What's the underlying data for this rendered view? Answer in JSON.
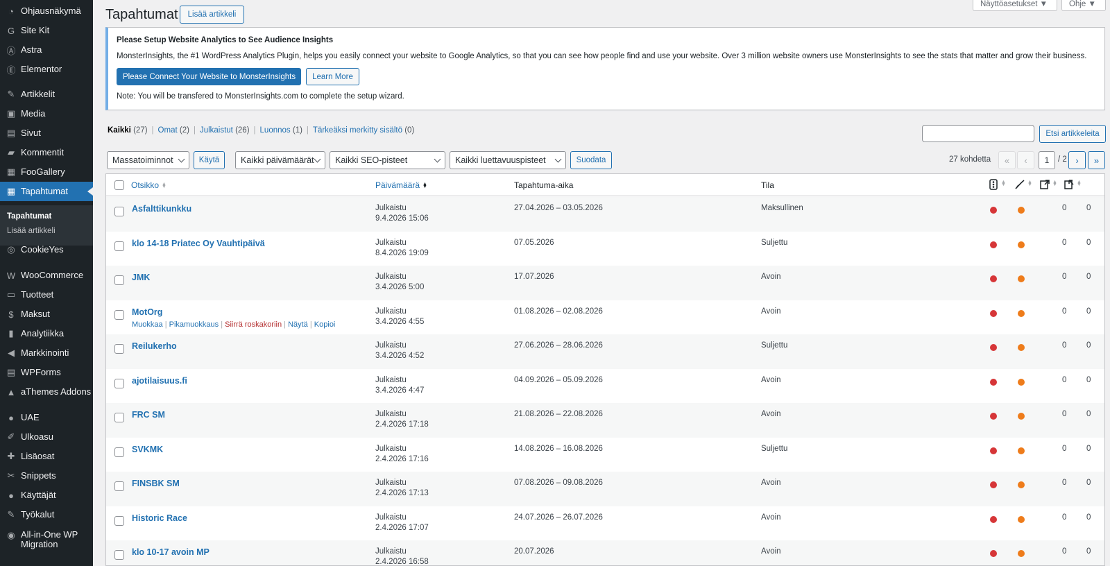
{
  "sidebar": {
    "items": [
      {
        "label": "Ohjausnäkymä",
        "icon": "dashboard-icon",
        "glyph": "◔"
      },
      {
        "label": "Site Kit",
        "icon": "site-kit-icon",
        "glyph": "G"
      },
      {
        "label": "Astra",
        "icon": "astra-icon",
        "glyph": "Ⓐ"
      },
      {
        "label": "Elementor",
        "icon": "elementor-icon",
        "glyph": "Ⓔ"
      },
      {
        "label": "Artikkelit",
        "icon": "pin-icon",
        "glyph": "✎"
      },
      {
        "label": "Media",
        "icon": "media-icon",
        "glyph": "▣"
      },
      {
        "label": "Sivut",
        "icon": "pages-icon",
        "glyph": "▤"
      },
      {
        "label": "Kommentit",
        "icon": "comments-icon",
        "glyph": "▰"
      },
      {
        "label": "FooGallery",
        "icon": "gallery-icon",
        "glyph": "▦"
      },
      {
        "label": "Tapahtumat",
        "icon": "calendar-icon",
        "glyph": "▦"
      },
      {
        "label": "CookieYes",
        "icon": "cookie-icon",
        "glyph": "◎"
      },
      {
        "label": "WooCommerce",
        "icon": "woocommerce-icon",
        "glyph": "W"
      },
      {
        "label": "Tuotteet",
        "icon": "products-icon",
        "glyph": "▭"
      },
      {
        "label": "Maksut",
        "icon": "payments-icon",
        "glyph": "$"
      },
      {
        "label": "Analytiikka",
        "icon": "analytics-icon",
        "glyph": "▮"
      },
      {
        "label": "Markkinointi",
        "icon": "marketing-icon",
        "glyph": "◀"
      },
      {
        "label": "WPForms",
        "icon": "wpforms-icon",
        "glyph": "▤"
      },
      {
        "label": "aThemes Addons",
        "icon": "athemes-icon",
        "glyph": "▲"
      },
      {
        "label": "UAE",
        "icon": "uae-icon",
        "glyph": "●"
      },
      {
        "label": "Ulkoasu",
        "icon": "appearance-icon",
        "glyph": "✐"
      },
      {
        "label": "Lisäosat",
        "icon": "plugins-icon",
        "glyph": "✚"
      },
      {
        "label": "Snippets",
        "icon": "snippets-icon",
        "glyph": "✂"
      },
      {
        "label": "Käyttäjät",
        "icon": "users-icon",
        "glyph": "●"
      },
      {
        "label": "Työkalut",
        "icon": "tools-icon",
        "glyph": "✎"
      },
      {
        "label": "All-in-One WP Migration",
        "icon": "migration-icon",
        "glyph": "◉"
      }
    ],
    "submenu": [
      "Tapahtumat",
      "Lisää artikkeli"
    ]
  },
  "header": {
    "title": "Tapahtumat",
    "add_new": "Lisää artikkeli",
    "screen_options": "Näyttöasetukset ▼",
    "help": "Ohje ▼"
  },
  "notice": {
    "title": "Please Setup Website Analytics to See Audience Insights",
    "body": "MonsterInsights, the #1 WordPress Analytics Plugin, helps you easily connect your website to Google Analytics, so that you can see how people find and use your website. Over 3 million website owners use MonsterInsights to see the stats that matter and grow their business.",
    "connect_btn": "Please Connect Your Website to MonsterInsights",
    "learn_more": "Learn More",
    "note": "Note: You will be transfered to MonsterInsights.com to complete the setup wizard."
  },
  "views": [
    {
      "label": "Kaikki",
      "count": "(27)"
    },
    {
      "label": "Omat",
      "count": "(2)"
    },
    {
      "label": "Julkaistut",
      "count": "(26)"
    },
    {
      "label": "Luonnos",
      "count": "(1)"
    },
    {
      "label": "Tärkeäksi merkitty sisältö",
      "count": "(0)"
    }
  ],
  "search": {
    "button": "Etsi artikkeleita",
    "value": ""
  },
  "filters": {
    "bulk": "Massatoiminnot",
    "apply": "Käytä",
    "dates": "Kaikki päivämäärät",
    "seo": "Kaikki SEO-pisteet",
    "readability": "Kaikki luettavuuspisteet",
    "filter_btn": "Suodata"
  },
  "pagination": {
    "count": "27 kohdetta",
    "first": "«",
    "prev": "‹",
    "next": "›",
    "last": "»",
    "current": "1",
    "total": "/ 2"
  },
  "table": {
    "headers": {
      "title": "Otsikko",
      "date": "Päivämäärä",
      "event_time": "Tapahtuma-aika",
      "status": "Tila"
    },
    "row_actions": {
      "edit": "Muokkaa",
      "quick_edit": "Pikamuokkaus",
      "trash": "Siirrä roskakoriin",
      "view": "Näytä",
      "copy": "Kopioi"
    },
    "colors": {
      "seo_dot": "#d63638",
      "readability_dot": "#ee7c1b"
    },
    "rows": [
      {
        "title": "Asfalttikunkku",
        "status": "Julkaistu",
        "date": "9.4.2026 15:06",
        "event_time": "27.04.2026 – 03.05.2026",
        "tila": "Maksullinen",
        "links": "0",
        "linked": "0"
      },
      {
        "title": "klo 14-18 Priatec Oy Vauhtipäivä",
        "status": "Julkaistu",
        "date": "8.4.2026 19:09",
        "event_time": "07.05.2026",
        "tila": "Suljettu",
        "links": "0",
        "linked": "0"
      },
      {
        "title": "JMK",
        "status": "Julkaistu",
        "date": "3.4.2026 5:00",
        "event_time": "17.07.2026",
        "tila": "Avoin",
        "links": "0",
        "linked": "0"
      },
      {
        "title": "MotOrg",
        "status": "Julkaistu",
        "date": "3.4.2026 4:55",
        "event_time": "01.08.2026 – 02.08.2026",
        "tila": "Avoin",
        "links": "0",
        "linked": "0"
      },
      {
        "title": "Reilukerho",
        "status": "Julkaistu",
        "date": "3.4.2026 4:52",
        "event_time": "27.06.2026 – 28.06.2026",
        "tila": "Suljettu",
        "links": "0",
        "linked": "0"
      },
      {
        "title": "ajotilaisuus.fi",
        "status": "Julkaistu",
        "date": "3.4.2026 4:47",
        "event_time": "04.09.2026 – 05.09.2026",
        "tila": "Avoin",
        "links": "0",
        "linked": "0"
      },
      {
        "title": "FRC SM",
        "status": "Julkaistu",
        "date": "2.4.2026 17:18",
        "event_time": "21.08.2026 – 22.08.2026",
        "tila": "Avoin",
        "links": "0",
        "linked": "0"
      },
      {
        "title": "SVKMK",
        "status": "Julkaistu",
        "date": "2.4.2026 17:16",
        "event_time": "14.08.2026 – 16.08.2026",
        "tila": "Suljettu",
        "links": "0",
        "linked": "0"
      },
      {
        "title": "FINSBK SM",
        "status": "Julkaistu",
        "date": "2.4.2026 17:13",
        "event_time": "07.08.2026 – 09.08.2026",
        "tila": "Avoin",
        "links": "0",
        "linked": "0"
      },
      {
        "title": "Historic Race",
        "status": "Julkaistu",
        "date": "2.4.2026 17:07",
        "event_time": "24.07.2026 – 26.07.2026",
        "tila": "Avoin",
        "links": "0",
        "linked": "0"
      },
      {
        "title": "klo 10-17 avoin MP",
        "status": "Julkaistu",
        "date": "2.4.2026 16:58",
        "event_time": "20.07.2026",
        "tila": "Avoin",
        "links": "0",
        "linked": "0"
      }
    ]
  }
}
